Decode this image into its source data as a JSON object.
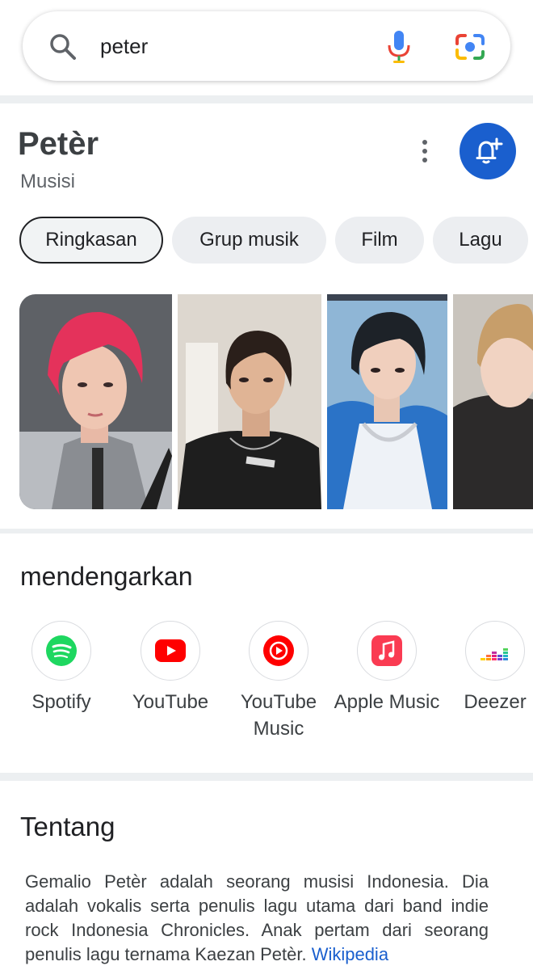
{
  "search": {
    "query": "peter"
  },
  "entity": {
    "title": "Petèr",
    "subtitle": "Musisi"
  },
  "chips": [
    "Ringkasan",
    "Grup musik",
    "Film",
    "Lagu"
  ],
  "listen": {
    "title": "mendengarkan",
    "apps": [
      {
        "label": "Spotify",
        "icon": "spotify-icon"
      },
      {
        "label": "YouTube",
        "icon": "youtube-icon"
      },
      {
        "label": "YouTube Music",
        "icon": "youtube-music-icon"
      },
      {
        "label": "Apple Music",
        "icon": "apple-music-icon"
      },
      {
        "label": "Deezer",
        "icon": "deezer-icon"
      }
    ]
  },
  "about": {
    "title": "Tentang",
    "text": "Gemalio Petèr adalah seorang musisi Indonesia. Dia adalah vokalis serta penulis lagu utama dari band indie rock Indonesia Chronicles. Anak pertam dari seorang penulis lagu ternama Kaezan Petèr.",
    "source": "Wikipedia"
  },
  "colors": {
    "accent": "#1a5fce",
    "chip_bg": "#eceef1",
    "band": "#eceff1"
  }
}
